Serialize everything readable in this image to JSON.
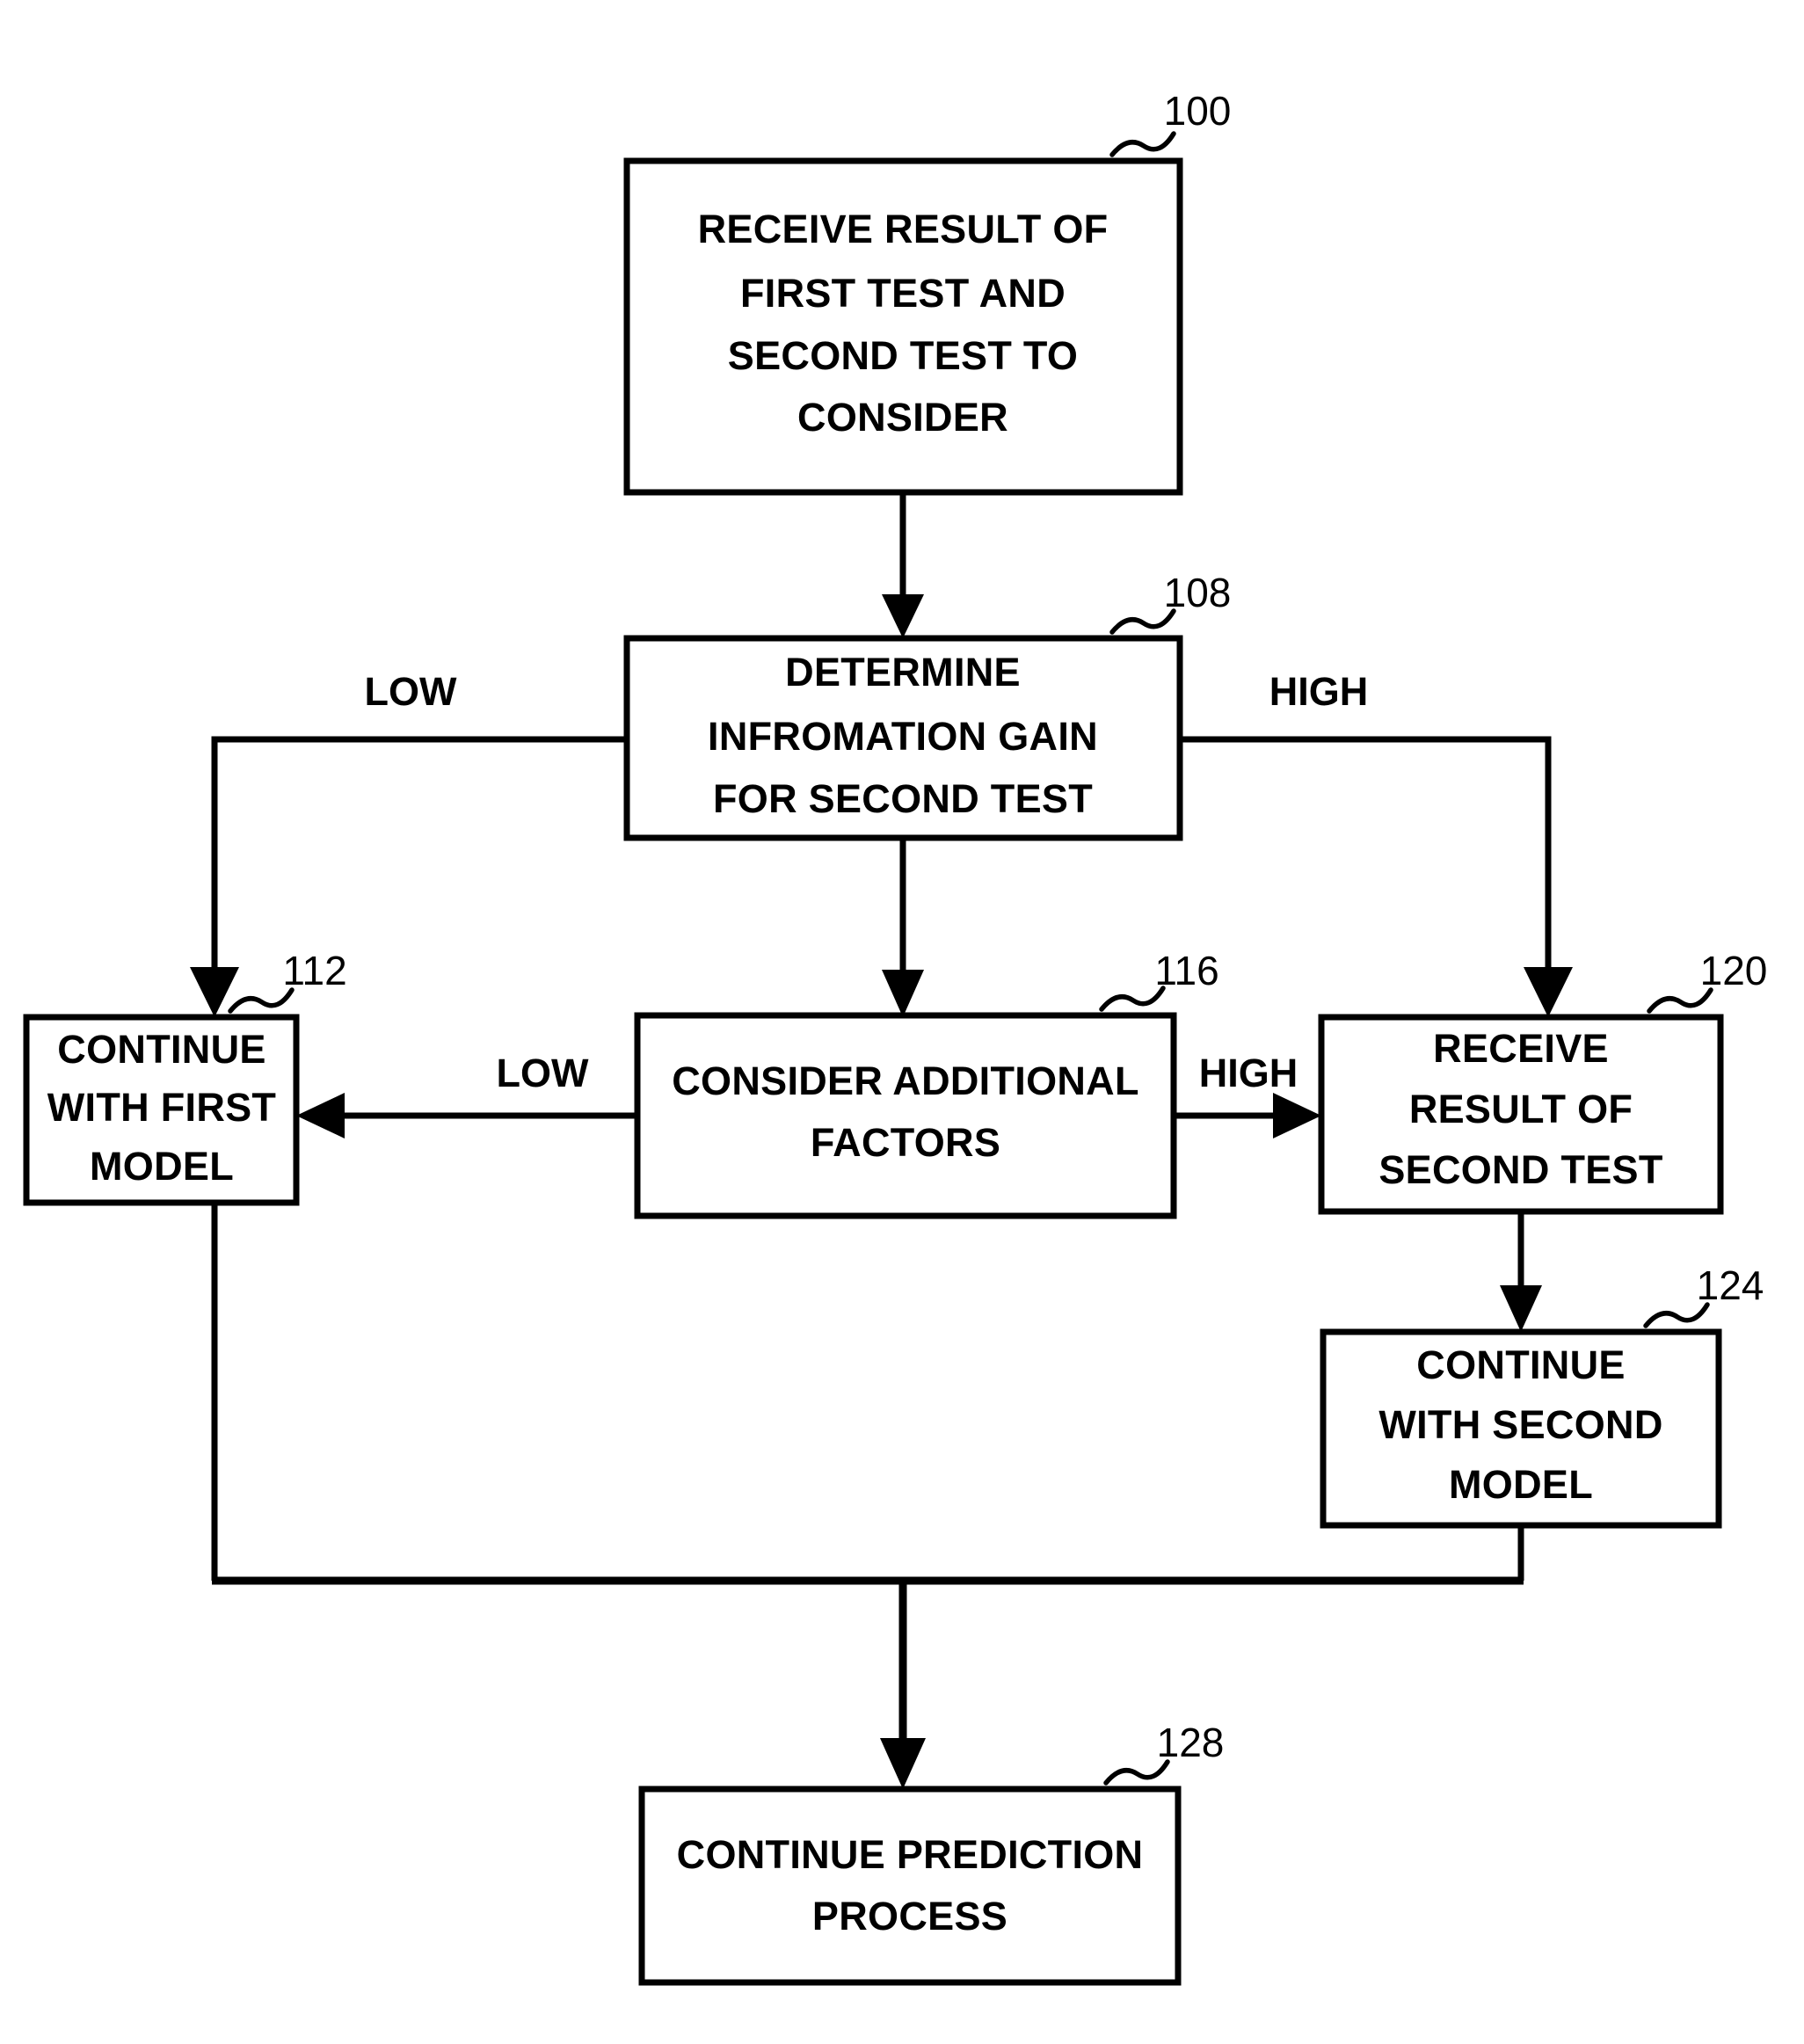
{
  "diagram": {
    "type": "flowchart",
    "title": "",
    "nodes": [
      {
        "id": "n100",
        "ref": "100",
        "lines": [
          "RECEIVE  RESULT OF",
          "FIRST TEST AND",
          "SECOND TEST TO",
          "CONSIDER"
        ]
      },
      {
        "id": "n108",
        "ref": "108",
        "lines": [
          "DETERMINE",
          "INFROMATION GAIN",
          "FOR SECOND TEST"
        ]
      },
      {
        "id": "n112",
        "ref": "112",
        "lines": [
          "CONTINUE",
          "WITH FIRST",
          "MODEL"
        ]
      },
      {
        "id": "n116",
        "ref": "116",
        "lines": [
          "CONSIDER ADDITIONAL",
          "FACTORS"
        ]
      },
      {
        "id": "n120",
        "ref": "120",
        "lines": [
          "RECEIVE",
          "RESULT OF",
          "SECOND TEST"
        ]
      },
      {
        "id": "n124",
        "ref": "124",
        "lines": [
          "CONTINUE",
          "WITH SECOND",
          "MODEL"
        ]
      },
      {
        "id": "n128",
        "ref": "128",
        "lines": [
          "CONTINUE PREDICTION",
          "PROCESS"
        ]
      }
    ],
    "edge_labels": [
      {
        "id": "e_low_top",
        "text": "LOW"
      },
      {
        "id": "e_high_top",
        "text": "HIGH"
      },
      {
        "id": "e_low_mid",
        "text": "LOW"
      },
      {
        "id": "e_high_mid",
        "text": "HIGH"
      }
    ],
    "colors": {
      "background": "#ffffff",
      "stroke": "#000000",
      "text": "#000000"
    }
  }
}
